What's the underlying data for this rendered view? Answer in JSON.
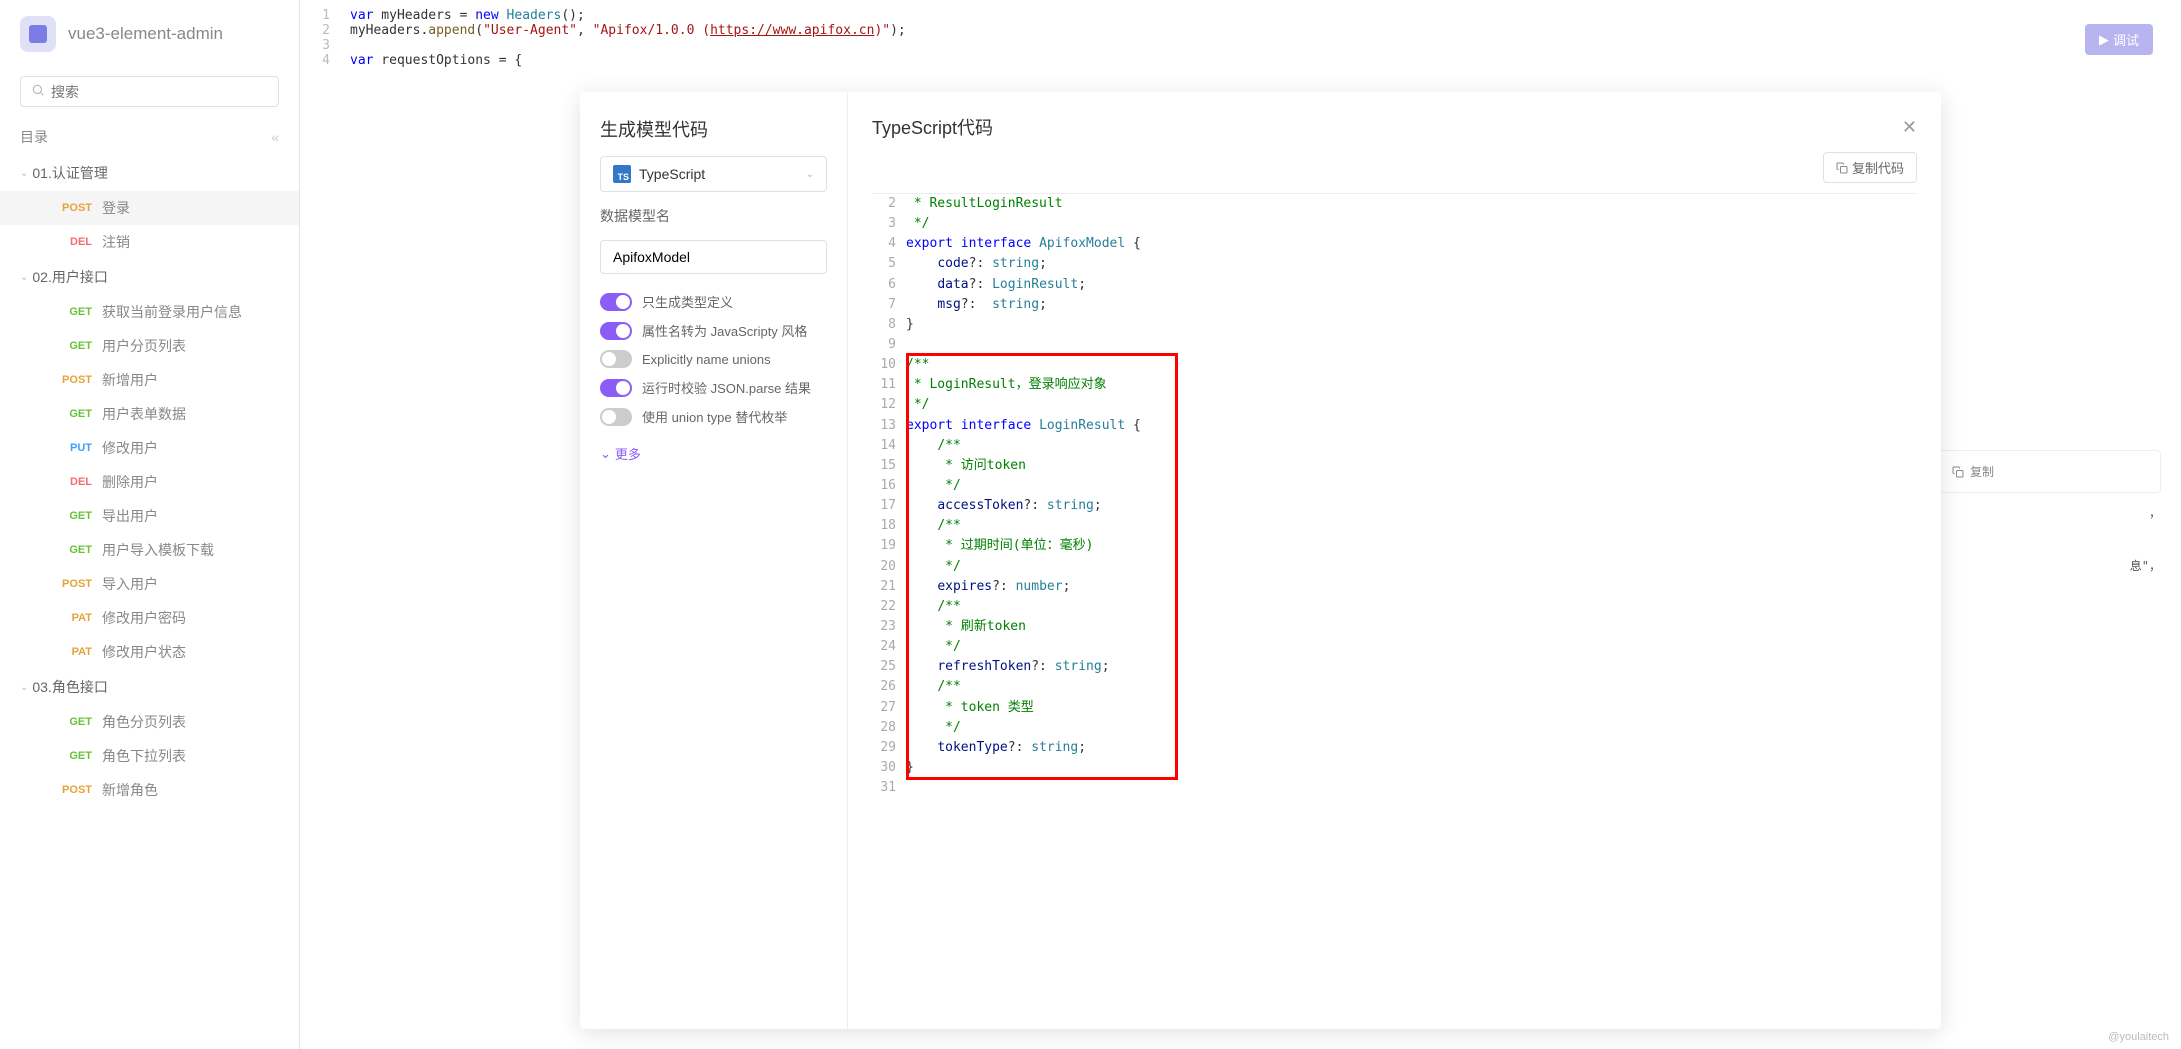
{
  "brand": {
    "title": "vue3-element-admin"
  },
  "search": {
    "placeholder": "搜索"
  },
  "catalog": {
    "title": "目录"
  },
  "tree": {
    "folders": [
      {
        "label": "01.认证管理",
        "expanded": true,
        "items": [
          {
            "method": "POST",
            "mclass": "m-post",
            "label": "登录",
            "active": true
          },
          {
            "method": "DEL",
            "mclass": "m-del",
            "label": "注销"
          }
        ]
      },
      {
        "label": "02.用户接口",
        "expanded": true,
        "items": [
          {
            "method": "GET",
            "mclass": "m-get",
            "label": "获取当前登录用户信息"
          },
          {
            "method": "GET",
            "mclass": "m-get",
            "label": "用户分页列表"
          },
          {
            "method": "POST",
            "mclass": "m-post",
            "label": "新增用户"
          },
          {
            "method": "GET",
            "mclass": "m-get",
            "label": "用户表单数据"
          },
          {
            "method": "PUT",
            "mclass": "m-put",
            "label": "修改用户"
          },
          {
            "method": "DEL",
            "mclass": "m-del",
            "label": "删除用户"
          },
          {
            "method": "GET",
            "mclass": "m-get",
            "label": "导出用户"
          },
          {
            "method": "GET",
            "mclass": "m-get",
            "label": "用户导入模板下载"
          },
          {
            "method": "POST",
            "mclass": "m-post",
            "label": "导入用户"
          },
          {
            "method": "PAT",
            "mclass": "m-pat",
            "label": "修改用户密码"
          },
          {
            "method": "PAT",
            "mclass": "m-pat",
            "label": "修改用户状态"
          }
        ]
      },
      {
        "label": "03.角色接口",
        "expanded": true,
        "items": [
          {
            "method": "GET",
            "mclass": "m-get",
            "label": "角色分页列表"
          },
          {
            "method": "GET",
            "mclass": "m-get",
            "label": "角色下拉列表"
          },
          {
            "method": "POST",
            "mclass": "m-post",
            "label": "新增角色"
          }
        ]
      }
    ]
  },
  "bgcode": {
    "lines": [
      {
        "n": "1",
        "html": "<span class='kw'>var</span> myHeaders = <span class='kw'>new</span> <span class='cls2'>Headers</span>();"
      },
      {
        "n": "2",
        "html": "myHeaders.<span class='fn'>append</span>(<span class='str'>\"User-Agent\"</span>, <span class='str'>\"Apifox/1.0.0 (<span class='lnk'>https://www.apifox.cn</span>)\"</span>);"
      },
      {
        "n": "3",
        "html": ""
      },
      {
        "n": "4",
        "html": "<span class='kw'>var</span> requestOptions = {"
      }
    ]
  },
  "debugBtn": "调试",
  "modal": {
    "leftTitle": "生成模型代码",
    "lang": "TypeScript",
    "modelNameLabel": "数据模型名",
    "modelName": "ApifoxModel",
    "toggles": [
      {
        "on": true,
        "label": "只生成类型定义"
      },
      {
        "on": true,
        "label": "属性名转为 JavaScripty 风格"
      },
      {
        "on": false,
        "label": "Explicitly name unions"
      },
      {
        "on": true,
        "label": "运行时校验 JSON.parse 结果"
      },
      {
        "on": false,
        "label": "使用 union type 替代枚举"
      }
    ],
    "more": "更多",
    "rightTitle": "TypeScript代码",
    "copyBtn": "复制代码",
    "code": [
      {
        "n": "2",
        "h": false,
        "html": "<span class='cmt'> * ResultLoginResult</span>"
      },
      {
        "n": "3",
        "h": false,
        "html": "<span class='cmt'> */</span>"
      },
      {
        "n": "4",
        "h": false,
        "html": "<span class='kw2'>export</span> <span class='kw2'>interface</span> <span class='typ'>ApifoxModel</span> {"
      },
      {
        "n": "5",
        "h": false,
        "html": "    <span class='prop'>code</span>?: <span class='ptyp'>string</span>;"
      },
      {
        "n": "6",
        "h": false,
        "html": "    <span class='prop'>data</span>?: <span class='ptyp'>LoginResult</span>;"
      },
      {
        "n": "7",
        "h": false,
        "html": "    <span class='prop'>msg</span>?:  <span class='ptyp'>string</span>;"
      },
      {
        "n": "8",
        "h": false,
        "html": "}"
      },
      {
        "n": "9",
        "h": false,
        "html": ""
      },
      {
        "n": "10",
        "h": true,
        "html": "<span class='cmt'>/**</span>"
      },
      {
        "n": "11",
        "h": true,
        "html": "<span class='cmt'> * LoginResult，登录响应对象</span>"
      },
      {
        "n": "12",
        "h": true,
        "html": "<span class='cmt'> */</span>"
      },
      {
        "n": "13",
        "h": true,
        "html": "<span class='kw2'>export</span> <span class='kw2'>interface</span> <span class='typ'>LoginResult</span> {"
      },
      {
        "n": "14",
        "h": true,
        "html": "    <span class='cmt'>/**</span>"
      },
      {
        "n": "15",
        "h": true,
        "html": "    <span class='cmt'> * 访问token</span>"
      },
      {
        "n": "16",
        "h": true,
        "html": "    <span class='cmt'> */</span>"
      },
      {
        "n": "17",
        "h": true,
        "html": "    <span class='prop'>accessToken</span>?: <span class='ptyp'>string</span>;"
      },
      {
        "n": "18",
        "h": true,
        "html": "    <span class='cmt'>/**</span>"
      },
      {
        "n": "19",
        "h": true,
        "html": "    <span class='cmt'> * 过期时间(单位：毫秒)</span>"
      },
      {
        "n": "20",
        "h": true,
        "html": "    <span class='cmt'> */</span>"
      },
      {
        "n": "21",
        "h": true,
        "html": "    <span class='prop'>expires</span>?: <span class='ptyp'>number</span>;"
      },
      {
        "n": "22",
        "h": true,
        "html": "    <span class='cmt'>/**</span>"
      },
      {
        "n": "23",
        "h": true,
        "html": "    <span class='cmt'> * 刷新token</span>"
      },
      {
        "n": "24",
        "h": true,
        "html": "    <span class='cmt'> */</span>"
      },
      {
        "n": "25",
        "h": true,
        "html": "    <span class='prop'>refreshToken</span>?: <span class='ptyp'>string</span>;"
      },
      {
        "n": "26",
        "h": true,
        "html": "    <span class='cmt'>/**</span>"
      },
      {
        "n": "27",
        "h": true,
        "html": "    <span class='cmt'> * token 类型</span>"
      },
      {
        "n": "28",
        "h": true,
        "html": "    <span class='cmt'> */</span>"
      },
      {
        "n": "29",
        "h": true,
        "html": "    <span class='prop'>tokenType</span>?: <span class='ptyp'>string</span>;"
      },
      {
        "n": "30",
        "h": true,
        "html": "}"
      },
      {
        "n": "31",
        "h": false,
        "html": ""
      }
    ]
  },
  "rightPartial": {
    "copyBtn": "复制",
    "frag1": "，",
    "frag2": "息\"，"
  },
  "watermark": "@youlaitech"
}
